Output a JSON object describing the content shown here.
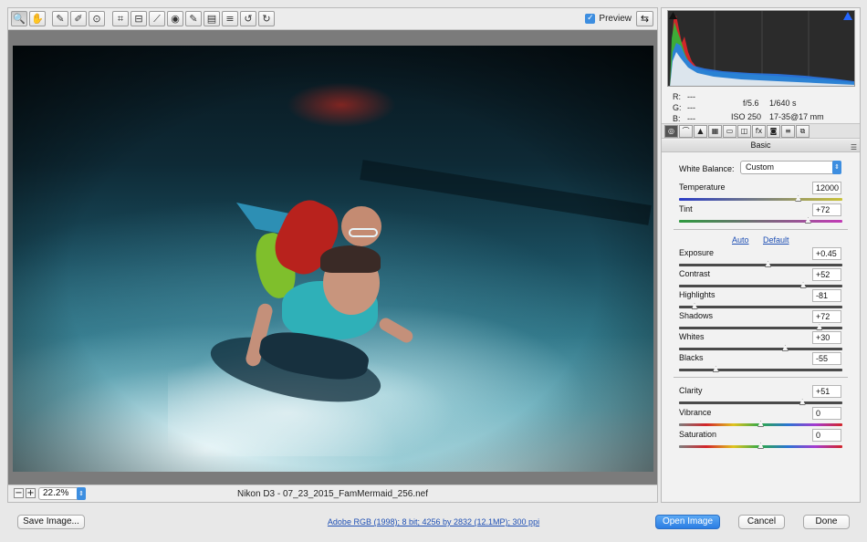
{
  "toolbar": {
    "tools": [
      {
        "icon": "zoom-icon",
        "glyph": "🔍"
      },
      {
        "icon": "hand-icon",
        "glyph": "✋"
      },
      {
        "icon": "white-balance-icon",
        "glyph": "✎"
      },
      {
        "icon": "color-sampler-icon",
        "glyph": "✐"
      },
      {
        "icon": "target-adjust-icon",
        "glyph": "⊙"
      },
      {
        "icon": "crop-icon",
        "glyph": "⌗"
      },
      {
        "icon": "straighten-icon",
        "glyph": "⊟"
      },
      {
        "icon": "spot-removal-icon",
        "glyph": "⟋"
      },
      {
        "icon": "red-eye-icon",
        "glyph": "◉"
      },
      {
        "icon": "adjustment-brush-icon",
        "glyph": "✎"
      },
      {
        "icon": "graduated-filter-icon",
        "glyph": "▤"
      },
      {
        "icon": "radial-filter-icon",
        "glyph": "≡"
      },
      {
        "icon": "rotate-left-icon",
        "glyph": "↺"
      },
      {
        "icon": "rotate-right-icon",
        "glyph": "↻"
      }
    ],
    "preview_label": "Preview",
    "preview_checked": true,
    "fullscreen_glyph": "⇆"
  },
  "status": {
    "zoom_out": "−",
    "zoom_in": "+",
    "zoom_level": "22.2%",
    "filename": "Nikon D3  -  07_23_2015_FamMermaid_256.nef"
  },
  "readout": {
    "r_label": "R:",
    "r_value": "---",
    "g_label": "G:",
    "g_value": "---",
    "b_label": "B:",
    "b_value": "---",
    "aperture": "f/5.6",
    "shutter": "1/640 s",
    "iso": "ISO 250",
    "lens": "17-35@17 mm"
  },
  "panel": {
    "title": "Basic",
    "menu_glyph": "☰",
    "tabs": [
      "◎",
      "⌒",
      "▲",
      "▦",
      "▭",
      "◫",
      "fx",
      "◙",
      "≡",
      "⧉"
    ],
    "white_balance_label": "White Balance:",
    "white_balance_value": "Custom",
    "auto_link": "Auto",
    "default_link": "Default",
    "sliders": [
      {
        "id": "temperature",
        "label": "Temperature",
        "value": "12000",
        "fraction": 0.73
      },
      {
        "id": "tint",
        "label": "Tint",
        "value": "+72",
        "fraction": 0.79
      },
      {
        "id": "exposure",
        "label": "Exposure",
        "value": "+0.45",
        "fraction": 0.545
      },
      {
        "id": "contrast",
        "label": "Contrast",
        "value": "+52",
        "fraction": 0.76
      },
      {
        "id": "highlights",
        "label": "Highlights",
        "value": "-81",
        "fraction": 0.095
      },
      {
        "id": "shadows",
        "label": "Shadows",
        "value": "+72",
        "fraction": 0.86
      },
      {
        "id": "whites",
        "label": "Whites",
        "value": "+30",
        "fraction": 0.65
      },
      {
        "id": "blacks",
        "label": "Blacks",
        "value": "-55",
        "fraction": 0.225
      },
      {
        "id": "clarity",
        "label": "Clarity",
        "value": "+51",
        "fraction": 0.755
      },
      {
        "id": "vibrance",
        "label": "Vibrance",
        "value": "0",
        "fraction": 0.5
      },
      {
        "id": "saturation",
        "label": "Saturation",
        "value": "0",
        "fraction": 0.5
      }
    ]
  },
  "bottom": {
    "save_label": "Save Image...",
    "workflow_text": "Adobe RGB (1998); 8 bit; 4256 by 2832 (12.1MP); 300 ppi",
    "open_label": "Open Image",
    "cancel_label": "Cancel",
    "done_label": "Done"
  },
  "colors": {
    "accent": "#2b7de3",
    "link": "#1e4fb4"
  }
}
